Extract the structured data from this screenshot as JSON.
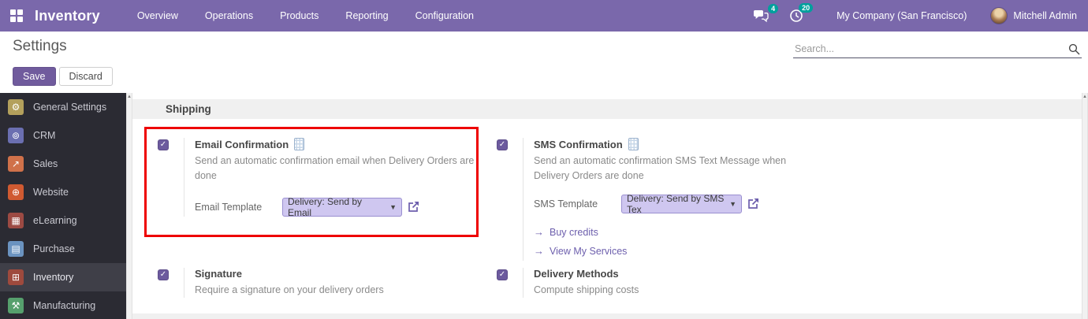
{
  "navbar": {
    "app_title": "Inventory",
    "menu_items": [
      "Overview",
      "Operations",
      "Products",
      "Reporting",
      "Configuration"
    ],
    "messages_badge": "4",
    "activities_badge": "20",
    "company": "My Company (San Francisco)",
    "user": "Mitchell Admin",
    "bg_color": "#7a68ab",
    "badge_color": "#00a09d"
  },
  "control_panel": {
    "title": "Settings",
    "save_label": "Save",
    "discard_label": "Discard",
    "search_placeholder": "Search..."
  },
  "sidebar": {
    "items": [
      {
        "label": "General Settings",
        "icon": "gear-icon",
        "glyph": "⚙",
        "color": "#b3a05c",
        "active": false
      },
      {
        "label": "CRM",
        "icon": "crm-icon",
        "glyph": "⊚",
        "color": "#6b6fb1",
        "active": false
      },
      {
        "label": "Sales",
        "icon": "sales-chart-icon",
        "glyph": "↗",
        "color": "#d0714a",
        "active": false
      },
      {
        "label": "Website",
        "icon": "globe-icon",
        "glyph": "⊕",
        "color": "#d05a31",
        "active": false
      },
      {
        "label": "eLearning",
        "icon": "presentation-icon",
        "glyph": "▦",
        "color": "#9c4a43",
        "active": false
      },
      {
        "label": "Purchase",
        "icon": "credit-card-icon",
        "glyph": "▤",
        "color": "#6b93c0",
        "active": false
      },
      {
        "label": "Inventory",
        "icon": "box-icon",
        "glyph": "⊞",
        "color": "#9e4a3d",
        "active": true
      },
      {
        "label": "Manufacturing",
        "icon": "wrench-icon",
        "glyph": "⚒",
        "color": "#56a06d",
        "active": false
      }
    ]
  },
  "content": {
    "section_title": "Shipping",
    "highlight_color": "#ee0000",
    "email_confirmation": {
      "label": "Email Confirmation",
      "checked": true,
      "description": "Send an automatic confirmation email when Delivery Orders are done",
      "field_label": "Email Template",
      "field_value": "Delivery: Send by Email"
    },
    "sms_confirmation": {
      "label": "SMS Confirmation",
      "checked": true,
      "description": "Send an automatic confirmation SMS Text Message when Delivery Orders are done",
      "field_label": "SMS Template",
      "field_value": "Delivery: Send by SMS Tex",
      "links": [
        "Buy credits",
        "View My Services"
      ]
    },
    "signature": {
      "label": "Signature",
      "checked": true,
      "description": "Require a signature on your delivery orders"
    },
    "delivery_methods": {
      "label": "Delivery Methods",
      "checked": true,
      "description": "Compute shipping costs"
    }
  }
}
